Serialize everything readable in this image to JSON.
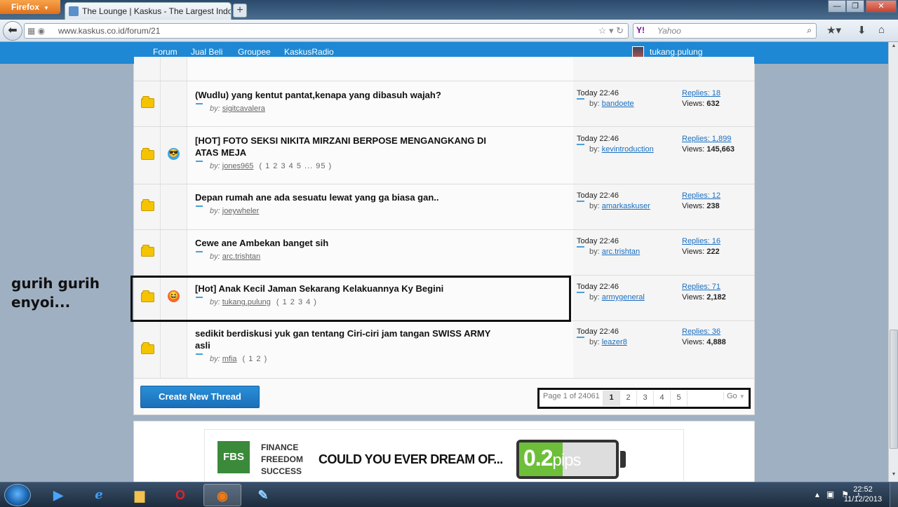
{
  "browser": {
    "app_button": "Firefox",
    "tab_title": "The Lounge | Kaskus - The Largest Indon...",
    "url": "www.kaskus.co.id/forum/21",
    "search_placeholder": "Yahoo",
    "search_engine": "Y!"
  },
  "site_nav": {
    "items": [
      "Forum",
      "Jual Beli",
      "Groupee",
      "KaskusRadio"
    ],
    "username": "tukang.pulung"
  },
  "threads": [
    {
      "title": "(Wudlu) yang kentut pantat,kenapa yang dibasuh wajah?",
      "by_label": "by:",
      "author": "sigitcavalera",
      "pages": "",
      "emoji": "",
      "last_time": "Today 22:46",
      "last_by": "bandoete",
      "replies": "Replies: 18",
      "views_label": "Views:",
      "views": "632"
    },
    {
      "title": "[HOT] FOTO SEKSI NIKITA MIRZANI BERPOSE MENGANGKANG DI ATAS MEJA",
      "by_label": "by:",
      "author": "jones965",
      "pages": "( 1 2 3 4 5 ... 95 )",
      "emoji": "cool",
      "last_time": "Today 22:46",
      "last_by": "kevintroduction",
      "replies": "Replies: 1,899",
      "views_label": "Views:",
      "views": "145,663"
    },
    {
      "title": "Depan rumah ane ada sesuatu lewat yang ga biasa gan..",
      "by_label": "by:",
      "author": "joeywheler",
      "pages": "",
      "emoji": "",
      "last_time": "Today 22:46",
      "last_by": "amarkaskuser",
      "replies": "Replies: 12",
      "views_label": "Views:",
      "views": "238"
    },
    {
      "title": "Cewe ane Ambekan banget sih",
      "by_label": "by:",
      "author": "arc.trishtan",
      "pages": "",
      "emoji": "",
      "last_time": "Today 22:46",
      "last_by": "arc.trishtan",
      "replies": "Replies: 16",
      "views_label": "Views:",
      "views": "222"
    },
    {
      "title": "[Hot] Anak Kecil Jaman Sekarang Kelakuannya Ky Begini",
      "by_label": "by:",
      "author": "tukang.pulung",
      "pages": "( 1 2 3 4 )",
      "emoji": "laugh",
      "last_time": "Today 22:46",
      "last_by": "armygeneral",
      "replies": "Replies: 71",
      "views_label": "Views:",
      "views": "2,182"
    },
    {
      "title": "sedikit berdiskusi yuk gan tentang Ciri-ciri jam tangan SWISS ARMY asli",
      "by_label": "by:",
      "author": "mfia",
      "pages": "( 1 2 )",
      "emoji": "",
      "last_time": "Today 22:46",
      "last_by": "leazer8",
      "replies": "Replies: 36",
      "views_label": "Views:",
      "views": "4,888"
    }
  ],
  "annotation": {
    "line1": "gurih gurih",
    "line2": "enyoi..."
  },
  "create_button": "Create New Thread",
  "pagination": {
    "info": "Page 1 of 24061",
    "pages": [
      "1",
      "2",
      "3",
      "4",
      "5"
    ],
    "current": "1",
    "go_label": "Go"
  },
  "ad": {
    "logo": "FBS",
    "tagline1": "FINANCE",
    "tagline2": "FREEDOM",
    "tagline3": "SUCCESS",
    "headline": "COULD YOU EVER DREAM OF...",
    "big_value": "0.2",
    "unit": "pips",
    "battery_level": 0.45
  },
  "taskbar": {
    "time": "22:52",
    "date": "11/12/2013"
  },
  "colors": {
    "site_blue": "#1e88d4",
    "link_blue": "#1a6fc0",
    "folder_yellow": "#f5c400"
  }
}
